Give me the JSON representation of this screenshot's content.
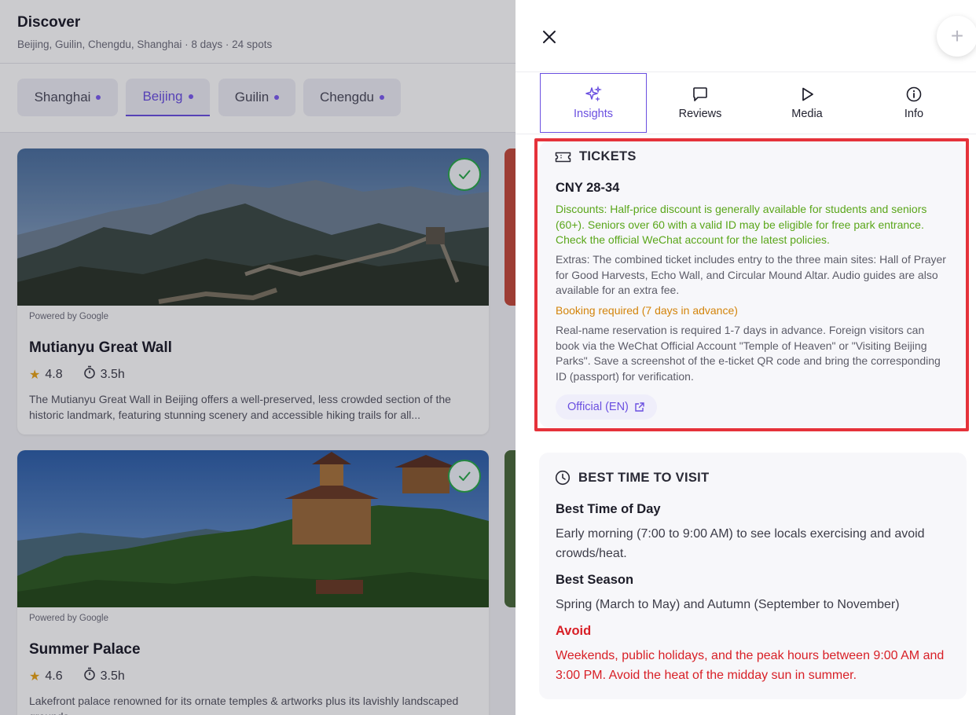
{
  "discover": {
    "title": "Discover",
    "subtitle": "Beijing, Guilin, Chengdu, Shanghai · 8 days · 24 spots"
  },
  "city_tabs": [
    {
      "label": "Shanghai",
      "active": false
    },
    {
      "label": "Beijing",
      "active": true
    },
    {
      "label": "Guilin",
      "active": false
    },
    {
      "label": "Chengdu",
      "active": false
    }
  ],
  "cards": [
    {
      "powered": "Powered by Google",
      "name": "Mutianyu Great Wall",
      "rating": "4.8",
      "duration": "3.5h",
      "description": "The Mutianyu Great Wall in Beijing offers a well-preserved, less crowded section of the historic landmark, featuring stunning scenery and accessible hiking trails for all..."
    },
    {
      "powered": "Powered by Google",
      "name": "Summer Palace",
      "rating": "4.6",
      "duration": "3.5h",
      "description": "Lakefront palace renowned for its ornate temples & artworks plus its lavishly landscaped grounds."
    }
  ],
  "panel": {
    "tabs": [
      {
        "label": "Insights",
        "icon": "sparkles-icon",
        "active": true
      },
      {
        "label": "Reviews",
        "icon": "chat-bubble-icon",
        "active": false
      },
      {
        "label": "Media",
        "icon": "play-icon",
        "active": false
      },
      {
        "label": "Info",
        "icon": "info-icon",
        "active": false
      }
    ],
    "tickets": {
      "heading": "TICKETS",
      "price": "CNY 28-34",
      "discounts": "Discounts: Half-price discount is generally available for students and seniors (60+). Seniors over 60 with a valid ID may be eligible for free park entrance. Check the official WeChat account for the latest policies.",
      "extras": "Extras: The combined ticket includes entry to the three main sites: Hall of Prayer for Good Harvests, Echo Wall, and Circular Mound Altar. Audio guides are also available for an extra fee.",
      "booking": "Booking required (7 days in advance)",
      "booking_details": "Real-name reservation is required 1-7 days in advance. Foreign visitors can book via the WeChat Official Account \"Temple of Heaven\" or \"Visiting Beijing Parks\". Save a screenshot of the e-ticket QR code and bring the corresponding ID (passport) for verification.",
      "official_link": "Official (EN)"
    },
    "best_time": {
      "heading": "BEST TIME TO VISIT",
      "day_label": "Best Time of Day",
      "day_text": "Early morning (7:00 to 9:00 AM) to see locals exercising and avoid crowds/heat.",
      "season_label": "Best Season",
      "season_text": "Spring (March to May) and Autumn (September to November)",
      "avoid_label": "Avoid",
      "avoid_text": "Weekends, public holidays, and the peak hours between 9:00 AM and 3:00 PM. Avoid the heat of the midday sun in summer."
    }
  },
  "colors": {
    "accent": "#6a4fe0",
    "highlight_border": "#e5323a",
    "discount_green": "#5aa61a",
    "booking_orange": "#d3840b",
    "avoid_red": "#d81f26"
  }
}
